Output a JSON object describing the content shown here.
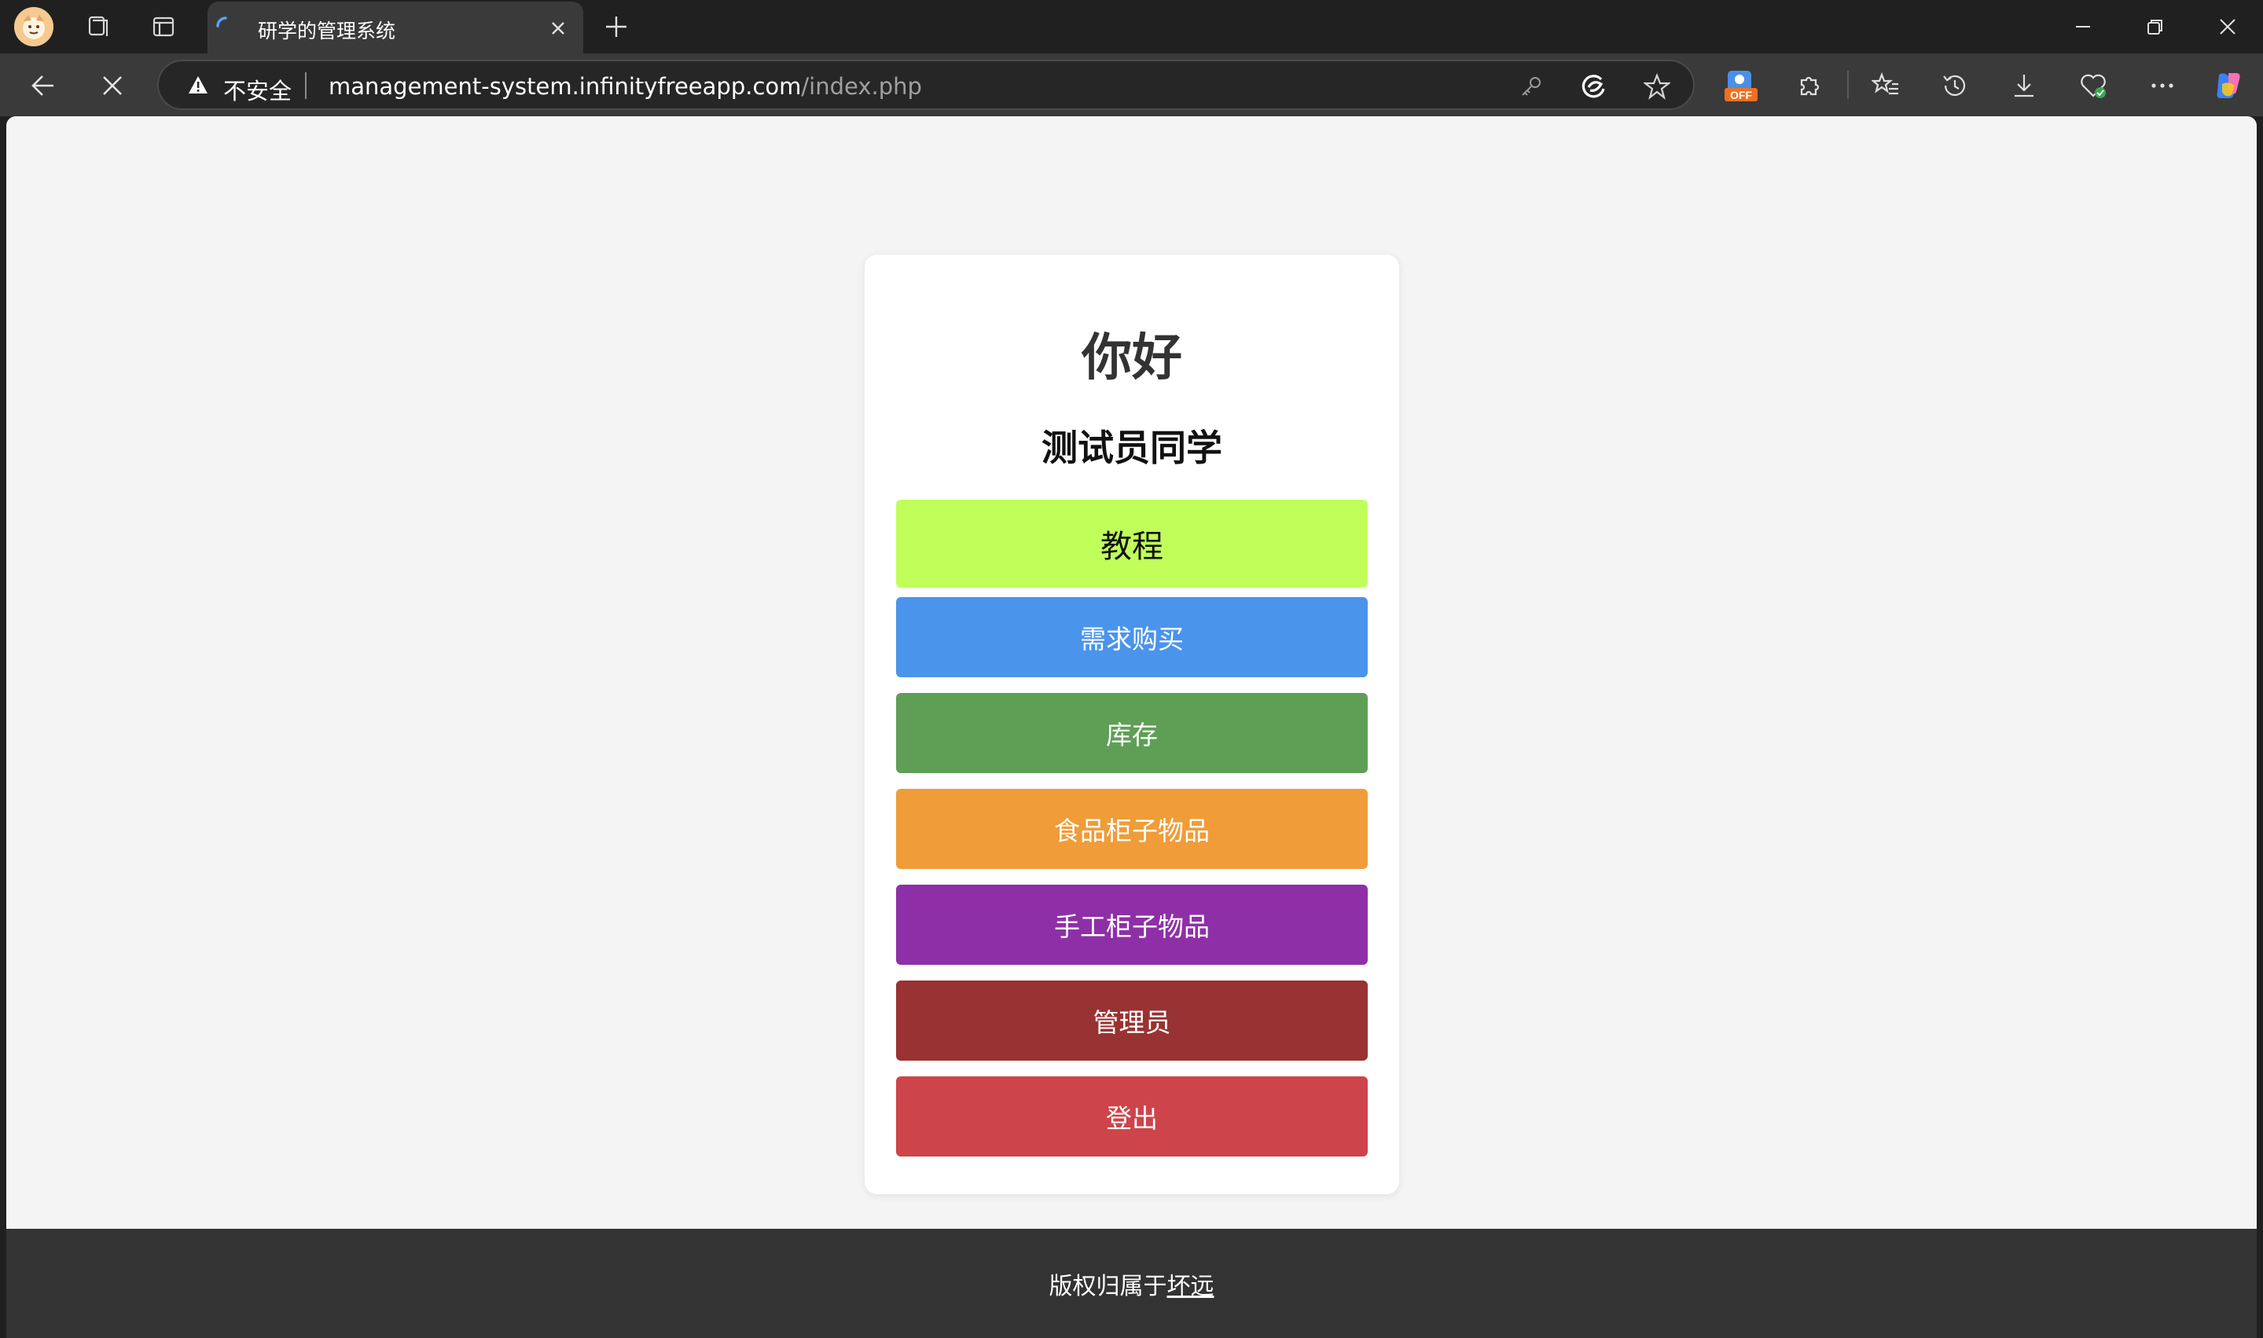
{
  "browser": {
    "tab": {
      "title": "研学的管理系统"
    },
    "address_bar": {
      "security_label": "不安全",
      "url_host": "management-system.infinityfreeapp.com",
      "url_path": "/index.php"
    },
    "extension_badge": "OFF"
  },
  "page": {
    "greeting": "你好",
    "username": "测试员同学",
    "menu": [
      {
        "label": "教程",
        "color": "#c0ff5a"
      },
      {
        "label": "需求购买",
        "color": "#4a94ec"
      },
      {
        "label": "库存",
        "color": "#5e9f55"
      },
      {
        "label": "食品柜子物品",
        "color": "#f09c38"
      },
      {
        "label": "手工柜子物品",
        "color": "#8f2fa7"
      },
      {
        "label": "管理员",
        "color": "#993232"
      },
      {
        "label": "登出",
        "color": "#cd444a"
      }
    ],
    "footer": {
      "prefix": "版权归属于",
      "link": "坏远"
    }
  },
  "colors": {
    "page_background": "#f4f4f4",
    "footer_background": "#333333",
    "browser_chrome": "#202020"
  }
}
